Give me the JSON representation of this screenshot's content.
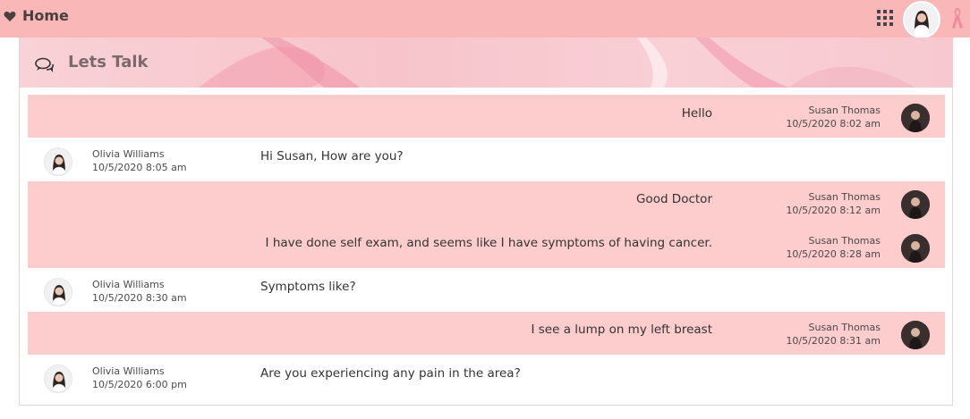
{
  "nav": {
    "home_label": "Home"
  },
  "banner": {
    "title": "Lets Talk"
  },
  "messages": [
    {
      "side": "sent",
      "text": "Hello",
      "sender": "Susan Thomas",
      "time": "10/5/2020 8:02  am"
    },
    {
      "side": "recv",
      "text": "Hi Susan, How are you?",
      "sender": "Olivia Williams",
      "time": "10/5/2020 8:05  am"
    },
    {
      "side": "sent",
      "text": "Good Doctor",
      "sender": "Susan Thomas",
      "time": "10/5/2020 8:12  am"
    },
    {
      "side": "sent",
      "text": "I have done self exam, and seems like I have symptoms of having cancer.",
      "sender": "Susan Thomas",
      "time": "10/5/2020 8:28  am"
    },
    {
      "side": "recv",
      "text": "Symptoms like?",
      "sender": "Olivia Williams",
      "time": "10/5/2020 8:30  am"
    },
    {
      "side": "sent",
      "text": "I see a lump on my left breast",
      "sender": "Susan Thomas",
      "time": "10/5/2020 8:31  am"
    },
    {
      "side": "recv",
      "text": "Are you experiencing any pain in the area?",
      "sender": "Olivia Williams",
      "time": "10/5/2020 6:00  pm"
    }
  ],
  "colors": {
    "topbar": "#f9b7b7",
    "sent_bubble": "#fdcccc",
    "received_bubble": "#ffffff"
  }
}
